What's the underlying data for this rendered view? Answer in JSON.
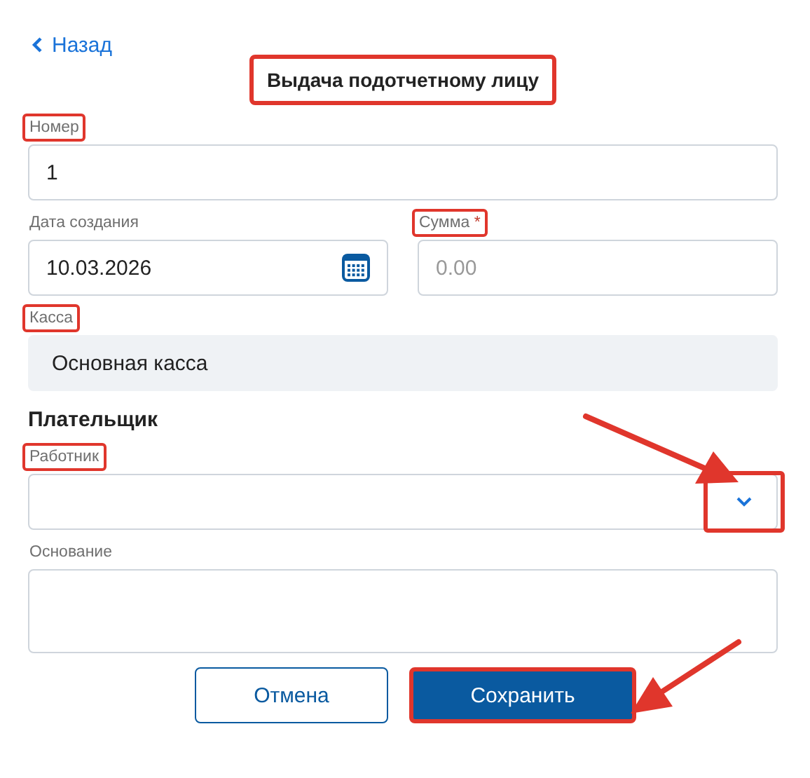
{
  "back_link": {
    "label": "Назад"
  },
  "title": {
    "text": "Выдача подотчетному лицу",
    "highlighted": true
  },
  "fields": [
    {
      "kind": "text",
      "label": "Номер",
      "highlighted": true,
      "value": "1"
    },
    {
      "kind": "date",
      "label": "Дата создания",
      "highlighted": false,
      "value": "10.03.2026"
    },
    {
      "kind": "text",
      "label": "Сумма",
      "required_mark": "*",
      "highlighted": true,
      "placeholder": "0.00"
    },
    {
      "kind": "readonly",
      "label": "Касса",
      "highlighted": true,
      "value": "Основная касса"
    },
    {
      "kind": "heading",
      "text": "Плательщик"
    },
    {
      "kind": "select",
      "label": "Работник",
      "highlighted": true,
      "button_highlighted": true,
      "arrow_pointing": true
    },
    {
      "kind": "textarea",
      "label": "Основание",
      "highlighted": false
    }
  ],
  "buttons": [
    {
      "kind": "secondary",
      "label": "Отмена",
      "highlighted": false,
      "arrow_pointing": false
    },
    {
      "kind": "primary",
      "label": "Сохранить",
      "highlighted": true,
      "arrow_pointing": true
    }
  ]
}
